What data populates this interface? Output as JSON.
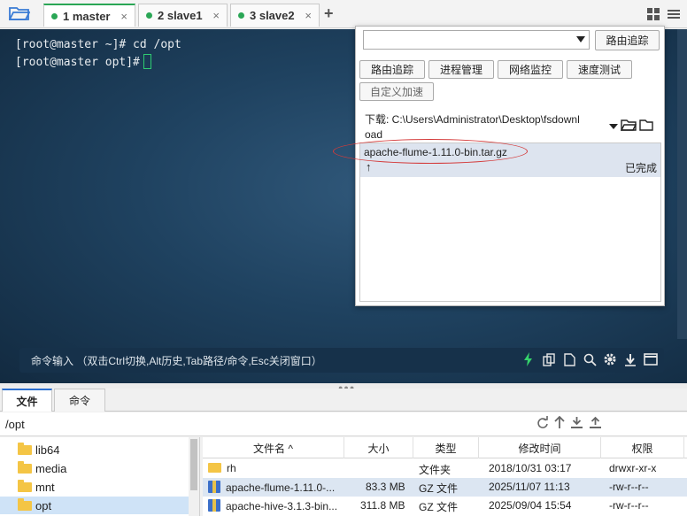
{
  "tabs": [
    {
      "label": "1 master"
    },
    {
      "label": "2 slave1"
    },
    {
      "label": "3 slave2"
    }
  ],
  "tab_close_symbol": "×",
  "add_tab_symbol": "+",
  "terminal": {
    "lines": [
      "[root@master ~]# cd /opt",
      "[root@master opt]#"
    ],
    "command_hint": "命令输入 （双击Ctrl切换,Alt历史,Tab路径/命令,Esc关闭窗口）",
    "icons": [
      "bolt-icon",
      "copy-icon",
      "file-icon",
      "search-icon",
      "gear-icon",
      "download-icon",
      "window-icon"
    ]
  },
  "panel": {
    "route_trace_top": "路由追踪",
    "buttons": [
      "路由追踪",
      "进程管理",
      "网络监控",
      "速度测试",
      "自定义加速"
    ],
    "download_label": "下载: C:\\Users\\Administrator\\Desktop\\fsdownload",
    "download_item": {
      "name": "apache-flume-1.11.0-bin.tar.gz",
      "arrow": "↑",
      "status": "已完成"
    }
  },
  "bottom_tabs": [
    "文件",
    "命令"
  ],
  "path": "/opt",
  "tree": [
    "lib64",
    "media",
    "mnt",
    "opt"
  ],
  "file_table": {
    "headers": [
      "文件名 ^",
      "大小",
      "类型",
      "修改时间",
      "权限"
    ],
    "rows": [
      {
        "name": "rh",
        "size": "",
        "type": "文件夹",
        "time": "2018/10/31 03:17",
        "perm": "drwxr-xr-x",
        "kind": "folder"
      },
      {
        "name": "apache-flume-1.11.0-...",
        "size": "83.3 MB",
        "type": "GZ 文件",
        "time": "2025/11/07 11:13",
        "perm": "-rw-r--r--",
        "kind": "gz"
      },
      {
        "name": "apache-hive-3.1.3-bin...",
        "size": "311.8 MB",
        "type": "GZ 文件",
        "time": "2025/09/04 15:54",
        "perm": "-rw-r--r--",
        "kind": "gz"
      }
    ]
  },
  "colors": {
    "accent_green": "#2aa655",
    "highlight_red": "#d43a3a",
    "terminal_bg": "#1f4260"
  }
}
